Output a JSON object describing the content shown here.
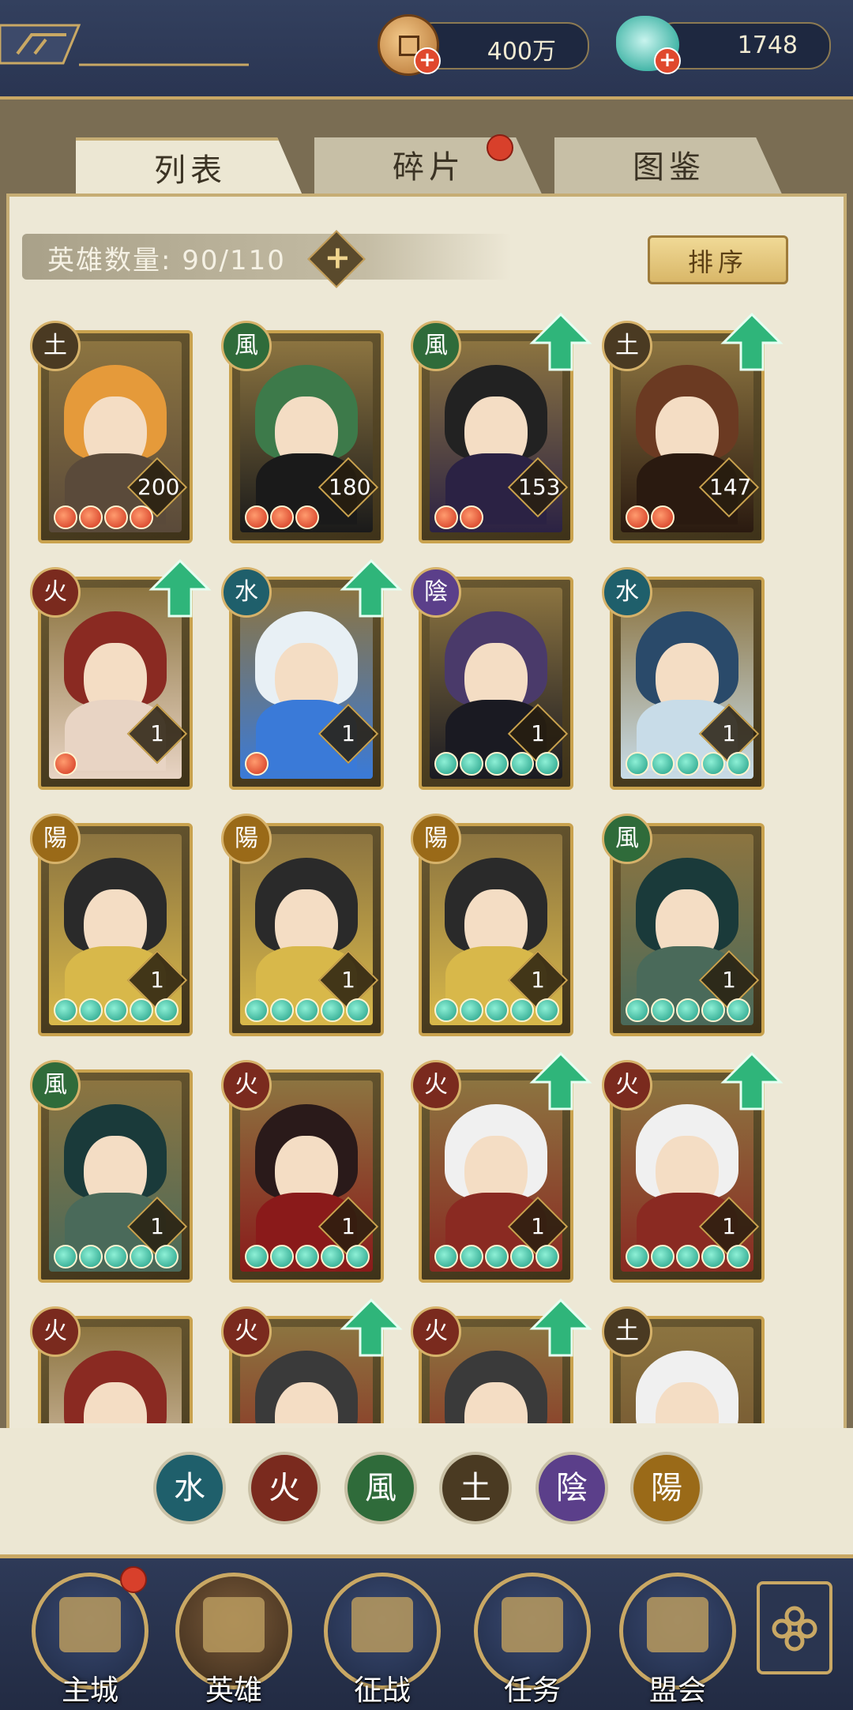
{
  "currency": {
    "copper": "400万",
    "jade": "1748"
  },
  "tabs": [
    {
      "label": "列表",
      "active": true
    },
    {
      "label": "碎片",
      "active": false,
      "badge": true
    },
    {
      "label": "图鉴",
      "active": false
    }
  ],
  "hero_count": {
    "label": "英雄数量: 90/110",
    "add_icon": "plus-icon"
  },
  "sort_label": "排序",
  "element_colors": {
    "土": "#4a3a22",
    "風": "#2f6b3a",
    "火": "#7a2a1e",
    "水": "#1f5f6b",
    "陰": "#5b3f8a",
    "陽": "#9a6a18"
  },
  "heroes": [
    {
      "element": "土",
      "level": "200",
      "stars": 4,
      "star_color": "red",
      "upgrade": false,
      "palette": [
        "#e59a3a",
        "#5a4a3a"
      ]
    },
    {
      "element": "風",
      "level": "180",
      "stars": 3,
      "star_color": "red",
      "upgrade": false,
      "palette": [
        "#3d7a4a",
        "#1a1a1a"
      ]
    },
    {
      "element": "風",
      "level": "153",
      "stars": 2,
      "star_color": "red",
      "upgrade": true,
      "palette": [
        "#222",
        "#2b2244"
      ]
    },
    {
      "element": "土",
      "level": "147",
      "stars": 2,
      "star_color": "red",
      "upgrade": true,
      "palette": [
        "#6b3a22",
        "#2a1a10"
      ]
    },
    {
      "element": "火",
      "level": "1",
      "stars": 1,
      "star_color": "red",
      "upgrade": true,
      "palette": [
        "#8a2a22",
        "#e8d4c4"
      ]
    },
    {
      "element": "水",
      "level": "1",
      "stars": 1,
      "star_color": "red",
      "upgrade": true,
      "palette": [
        "#e8f0f5",
        "#3a7ad8"
      ]
    },
    {
      "element": "陰",
      "level": "1",
      "stars": 5,
      "star_color": "green",
      "upgrade": false,
      "palette": [
        "#4a3a6a",
        "#1a1a22"
      ]
    },
    {
      "element": "水",
      "level": "1",
      "stars": 5,
      "star_color": "green",
      "upgrade": false,
      "palette": [
        "#2a4a6a",
        "#c8dce8"
      ]
    },
    {
      "element": "陽",
      "level": "1",
      "stars": 5,
      "star_color": "green",
      "upgrade": false,
      "palette": [
        "#2a2a2a",
        "#d8b84a"
      ]
    },
    {
      "element": "陽",
      "level": "1",
      "stars": 5,
      "star_color": "green",
      "upgrade": false,
      "palette": [
        "#2a2a2a",
        "#d8b84a"
      ]
    },
    {
      "element": "陽",
      "level": "1",
      "stars": 5,
      "star_color": "green",
      "upgrade": false,
      "palette": [
        "#2a2a2a",
        "#d8b84a"
      ]
    },
    {
      "element": "風",
      "level": "1",
      "stars": 5,
      "star_color": "green",
      "upgrade": false,
      "palette": [
        "#1a3a3a",
        "#4a6a5a"
      ]
    },
    {
      "element": "風",
      "level": "1",
      "stars": 5,
      "star_color": "green",
      "upgrade": false,
      "palette": [
        "#1a3a3a",
        "#4a6a5a"
      ]
    },
    {
      "element": "火",
      "level": "1",
      "stars": 5,
      "star_color": "green",
      "upgrade": false,
      "palette": [
        "#2a1a1a",
        "#8a1a1a"
      ]
    },
    {
      "element": "火",
      "level": "1",
      "stars": 5,
      "star_color": "green",
      "upgrade": true,
      "palette": [
        "#f0f0f0",
        "#8a2a22"
      ]
    },
    {
      "element": "火",
      "level": "1",
      "stars": 5,
      "star_color": "green",
      "upgrade": true,
      "palette": [
        "#f0f0f0",
        "#8a2a22"
      ]
    },
    {
      "element": "火",
      "level": "",
      "stars": 0,
      "star_color": "red",
      "upgrade": false,
      "palette": [
        "#8a2a22",
        "#e8d4c4"
      ]
    },
    {
      "element": "火",
      "level": "",
      "stars": 0,
      "star_color": "red",
      "upgrade": true,
      "palette": [
        "#3a3a3a",
        "#8a1a1a"
      ]
    },
    {
      "element": "火",
      "level": "",
      "stars": 0,
      "star_color": "red",
      "upgrade": true,
      "palette": [
        "#3a3a3a",
        "#8a1a1a"
      ]
    },
    {
      "element": "土",
      "level": "",
      "stars": 0,
      "star_color": "red",
      "upgrade": false,
      "palette": [
        "#f0f0f0",
        "#6a4a2a"
      ]
    }
  ],
  "filters": [
    "水",
    "火",
    "風",
    "土",
    "陰",
    "陽"
  ],
  "nav": [
    {
      "label": "主城",
      "badge": true
    },
    {
      "label": "英雄",
      "badge": false
    },
    {
      "label": "征战",
      "badge": false
    },
    {
      "label": "任务",
      "badge": false
    },
    {
      "label": "盟会",
      "badge": false
    }
  ]
}
